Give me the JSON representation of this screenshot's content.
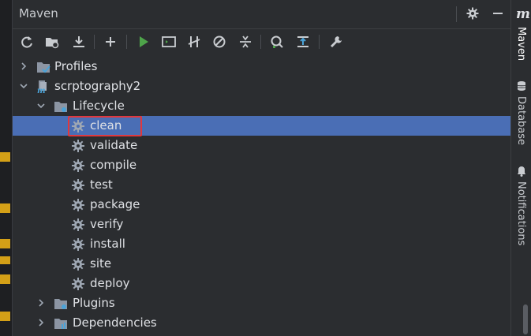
{
  "panel": {
    "title": "Maven"
  },
  "toolbar": {
    "buttons": [
      "reload-icon",
      "generate-sources-icon",
      "download-icon",
      "add-icon",
      "run-icon",
      "run-config-icon",
      "toggle-offline-icon",
      "skip-tests-icon",
      "collapse-all-icon",
      "analyze-dependencies-icon",
      "show-dependencies-icon",
      "settings-wrench-icon"
    ]
  },
  "tree": {
    "profiles": "Profiles",
    "project": "scrptography2",
    "lifecycle": "Lifecycle",
    "phases": [
      "clean",
      "validate",
      "compile",
      "test",
      "package",
      "verify",
      "install",
      "site",
      "deploy"
    ],
    "plugins": "Plugins",
    "dependencies": "Dependencies"
  },
  "side": {
    "logo": "m",
    "tabs": [
      "Maven",
      "Database",
      "Notifications"
    ]
  },
  "colors": {
    "selection": "#4a6eb5",
    "highlight": "#e0383e",
    "run": "#4ea44a",
    "folder": "#8c95a3",
    "gear": "#9ea7b3"
  }
}
